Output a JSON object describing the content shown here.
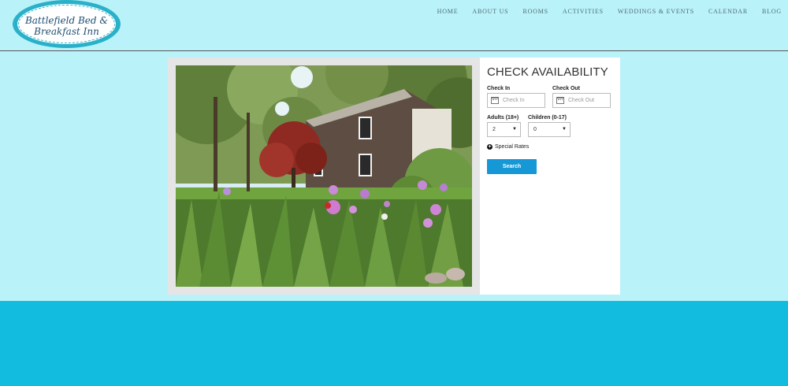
{
  "brand": {
    "line1": "Battlefield Bed &",
    "line2": "Breakfast Inn"
  },
  "nav": [
    "HOME",
    "ABOUT US",
    "ROOMS",
    "ACTIVITIES",
    "WEDDINGS & EVENTS",
    "CALENDAR",
    "BLOG"
  ],
  "booking": {
    "title": "CHECK AVAILABILITY",
    "check_in_label": "Check In",
    "check_in_placeholder": "Check In",
    "check_out_label": "Check Out",
    "check_out_placeholder": "Check Out",
    "adults_label": "Adults (18+)",
    "adults_value": "2",
    "children_label": "Children (0-17)",
    "children_value": "0",
    "special_rates": "Special Rates",
    "search": "Search"
  },
  "colors": {
    "background": "#baf2fa",
    "footer": "#11bcde",
    "button": "#1697d6",
    "logo": "#2ab1c9"
  }
}
